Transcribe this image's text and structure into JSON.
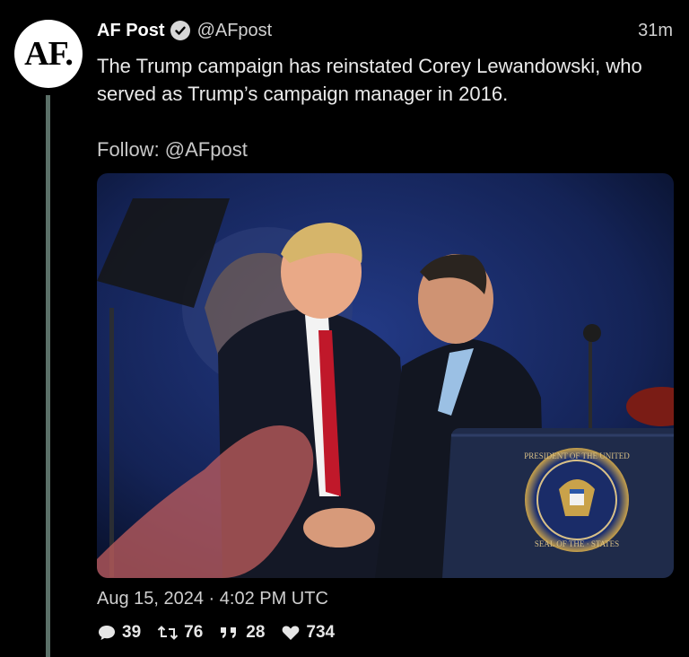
{
  "avatar": {
    "text": "AF."
  },
  "post": {
    "author_name": "AF Post",
    "handle": "@AFpost",
    "time_ago": "31m",
    "text": "The Trump campaign has reinstated Corey Lewandowski, who served as Trump’s campaign manager in 2016.",
    "follow_line": "Follow: @AFpost",
    "timestamp": "Aug 15, 2024 · 4:02 PM UTC"
  },
  "media": {
    "seal_top_text": "PRESIDENT OF THE UNITED",
    "seal_bottom_text": "SEAL OF THE · STATES"
  },
  "stats": {
    "replies": "39",
    "retweets": "76",
    "quotes": "28",
    "likes": "734"
  },
  "icons": {
    "verified": "verified-badge-icon",
    "reply": "speech-bubble-icon",
    "retweet": "retweet-icon",
    "quote": "quote-marks-icon",
    "like": "heart-icon"
  },
  "colors": {
    "background": "#000000",
    "thread_line": "#5b7068",
    "text": "#eaeaea"
  }
}
